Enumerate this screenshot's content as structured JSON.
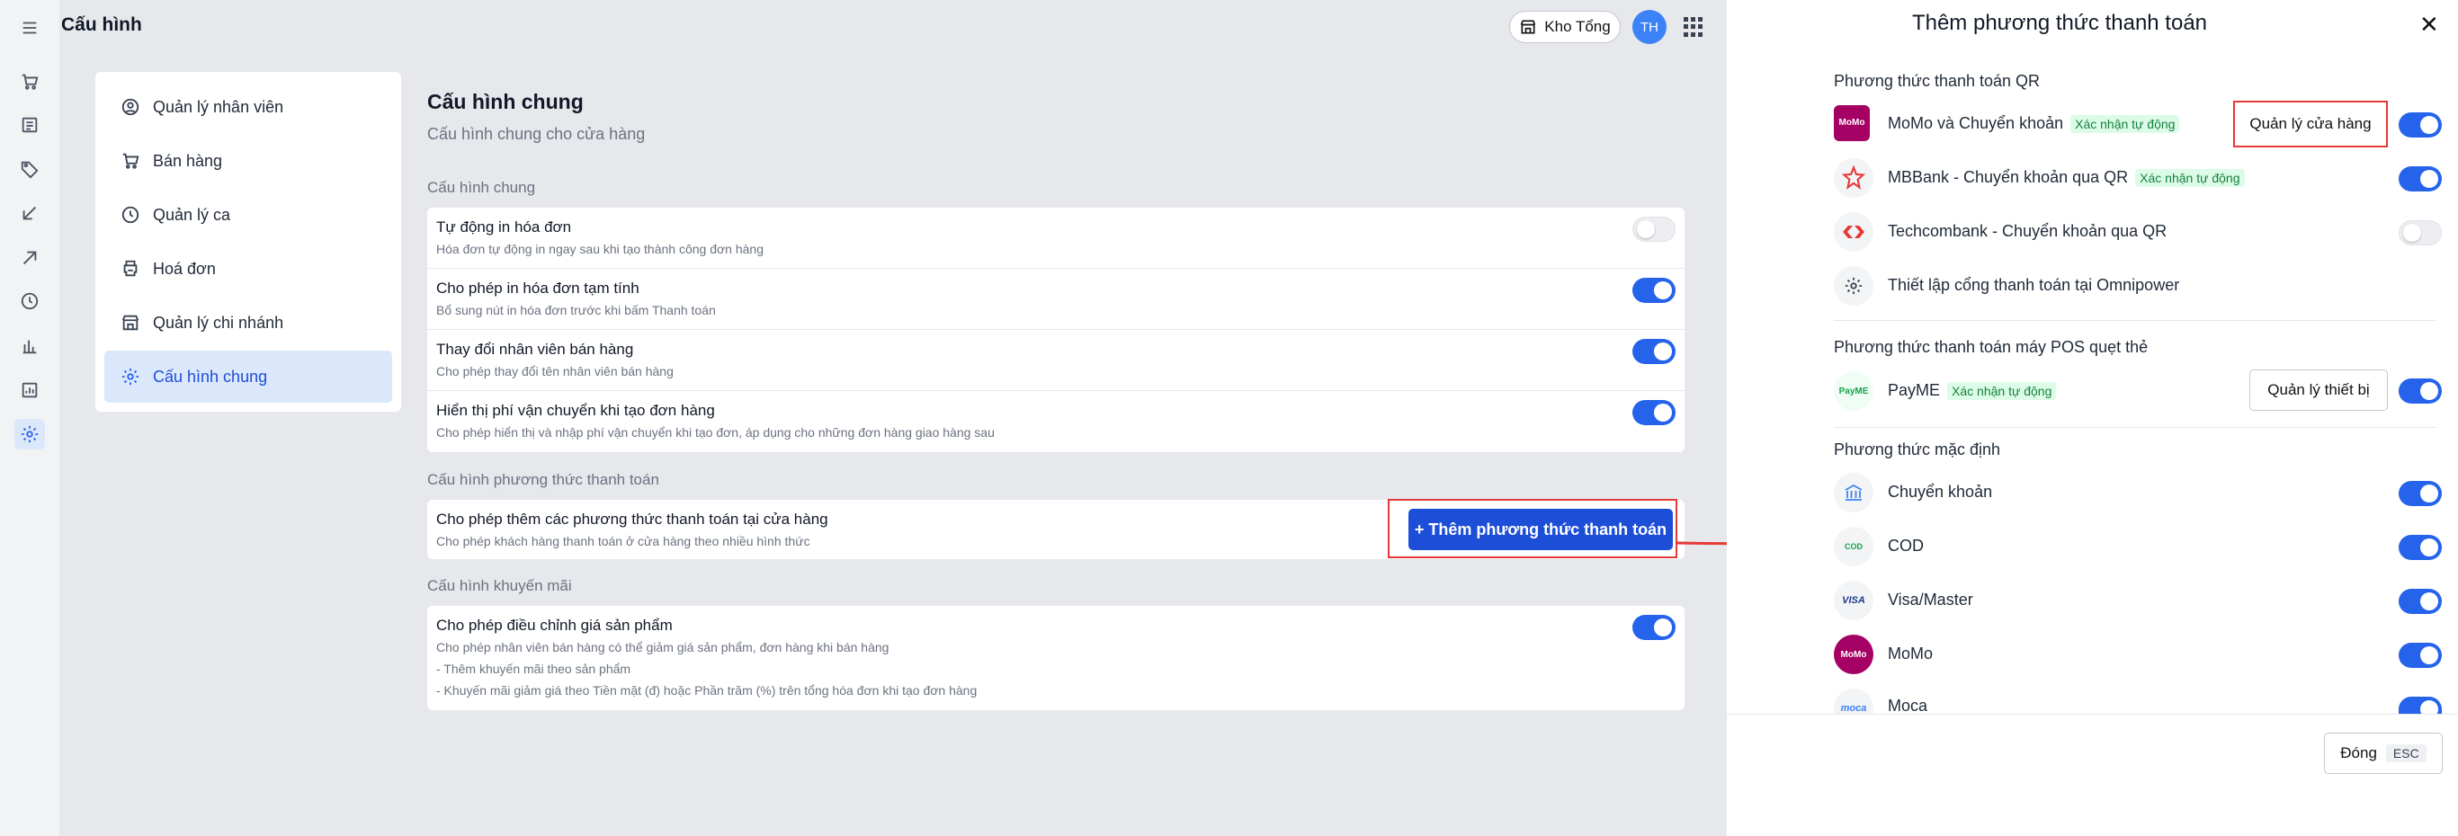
{
  "app": {
    "title": "Cấu hình",
    "store_button": "Kho Tổng",
    "avatar_initials": "TH"
  },
  "sidebar": {
    "items": [
      {
        "label": "Quản lý nhân viên",
        "icon": "user-circle-icon"
      },
      {
        "label": "Bán hàng",
        "icon": "cart-icon"
      },
      {
        "label": "Quản lý ca",
        "icon": "clock-icon"
      },
      {
        "label": "Hoá đơn",
        "icon": "printer-icon"
      },
      {
        "label": "Quản lý chi nhánh",
        "icon": "store-icon"
      },
      {
        "label": "Cấu hình chung",
        "icon": "gear-icon",
        "active": true
      }
    ]
  },
  "main": {
    "title": "Cấu hình chung",
    "subtitle": "Cấu hình chung cho cửa hàng",
    "sections": [
      {
        "title": "Cấu hình chung",
        "rows": [
          {
            "title": "Tự động in hóa đơn",
            "desc": "Hóa đơn tự động in ngay sau khi tạo thành công đơn hàng",
            "enabled": false
          },
          {
            "title": "Cho phép in hóa đơn tạm tính",
            "desc": "Bổ sung nút in hóa đơn trước khi bấm Thanh toán",
            "enabled": true
          },
          {
            "title": "Thay đổi nhân viên bán hàng",
            "desc": "Cho phép thay đổi tên nhân viên bán hàng",
            "enabled": true
          },
          {
            "title": "Hiển thị phí vận chuyển khi tạo đơn hàng",
            "desc": "Cho phép hiển thị và nhập phí vận chuyển khi tạo đơn, áp dụng cho những đơn hàng giao hàng sau",
            "enabled": true
          }
        ]
      },
      {
        "title": "Cấu hình phương thức thanh toán",
        "rows": [
          {
            "title": "Cho phép thêm các phương thức thanh toán tại cửa hàng",
            "desc": "Cho phép khách hàng thanh toán ở cửa hàng theo nhiều hình thức",
            "button": "+ Thêm phương thức thanh toán"
          }
        ]
      },
      {
        "title": "Cấu hình khuyến mãi",
        "rows": [
          {
            "title": "Cho phép điều chỉnh giá sản phẩm",
            "desc": "Cho phép nhân viên bán hàng có thể giảm giá sản phẩm, đơn hàng khi bán hàng",
            "desc2": "- Thêm khuyến mãi theo sản phẩm",
            "desc3": "- Khuyến mãi giảm giá theo Tiền mặt (đ) hoặc Phần trăm (%) trên tổng hóa đơn khi tạo đơn hàng",
            "enabled": true
          }
        ]
      }
    ]
  },
  "panel": {
    "title": "Thêm phương thức thanh toán",
    "qr_section": "Phương thức thanh toán QR",
    "qr_methods": [
      {
        "label": "MoMo và Chuyển khoản",
        "badge": "Xác nhận tự động",
        "button": "Quản lý cửa hàng",
        "enabled": true
      },
      {
        "label": "MBBank - Chuyển khoản qua QR",
        "badge": "Xác nhận tự động",
        "enabled": true
      },
      {
        "label": "Techcombank - Chuyển khoản qua QR",
        "enabled": false
      },
      {
        "label": "Thiết lập cổng thanh toán tại Omnipower"
      }
    ],
    "pos_section": "Phương thức thanh toán máy POS quẹt thẻ",
    "pos_methods": [
      {
        "label": "PayME",
        "badge": "Xác nhận tự động",
        "button": "Quản lý thiết bị",
        "enabled": true
      }
    ],
    "default_section": "Phương thức mặc định",
    "default_methods": [
      {
        "label": "Chuyển khoản",
        "enabled": true
      },
      {
        "label": "COD",
        "enabled": true
      },
      {
        "label": "Visa/Master",
        "enabled": true
      },
      {
        "label": "MoMo",
        "enabled": true
      },
      {
        "label": "Moca",
        "enabled": true
      }
    ],
    "close_button": "Đóng",
    "close_key": "ESC",
    "icon_text": {
      "momo": "MoMo",
      "payme": "PayME",
      "cod": "COD",
      "visa": "VISA",
      "moca": "moca"
    }
  },
  "colors": {
    "primary": "#2563eb",
    "button_blue": "#1d4ed8",
    "highlight_red": "#e53935",
    "badge_green": "#15803d",
    "momo_pink": "#a50064"
  }
}
